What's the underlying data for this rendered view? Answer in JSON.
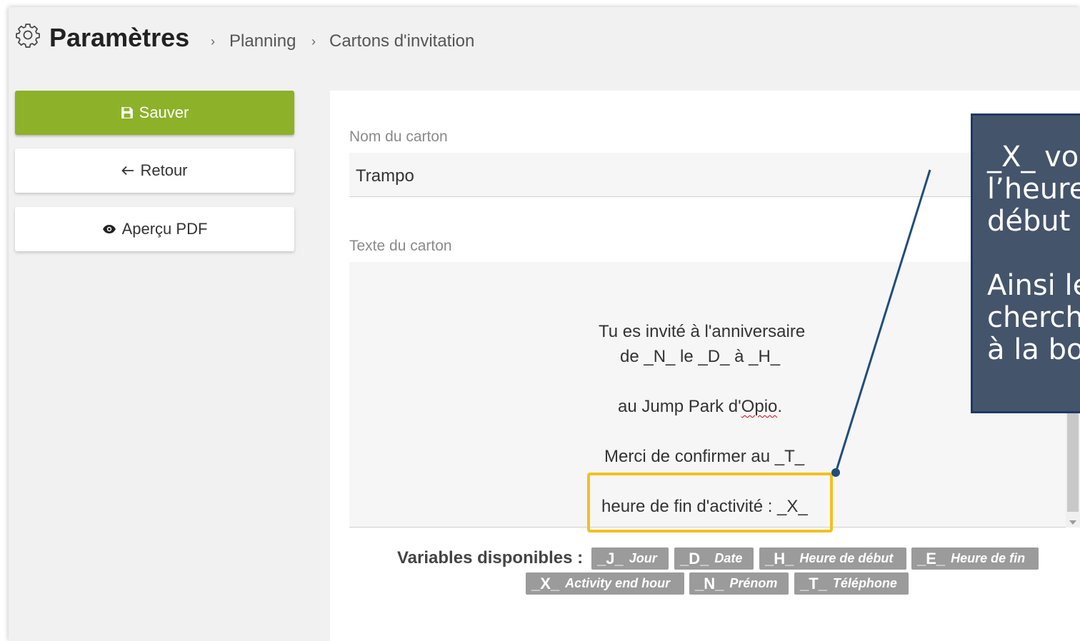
{
  "header": {
    "title": "Paramètres",
    "breadcrumb": [
      "Planning",
      "Cartons d'invitation"
    ],
    "separator": "›"
  },
  "actions": {
    "save_label": "Sauver",
    "back_label": "Retour",
    "pdf_label": "Aperçu PDF"
  },
  "form": {
    "name_label": "Nom du carton",
    "name_value": "Trampo",
    "text_label": "Texte du carton",
    "text_lines": [
      "Tu es invité à l'anniversaire",
      "de _N_ le _D_ à _H_",
      "au Jump Park d'",
      "Opio",
      ".",
      "Merci de confirmer au _T_",
      "heure de fin d'activité : _X_"
    ]
  },
  "variables": {
    "label": "Variables disponibles :",
    "items": [
      {
        "code": "_J_",
        "desc": "Jour"
      },
      {
        "code": "_D_",
        "desc": "Date"
      },
      {
        "code": "_H_",
        "desc": "Heure de début"
      },
      {
        "code": "_E_",
        "desc": "Heure de fin"
      },
      {
        "code": "_X_",
        "desc": "Activity end hour"
      },
      {
        "code": "_N_",
        "desc": "Prénom"
      },
      {
        "code": "_T_",
        "desc": "Téléphone"
      }
    ]
  },
  "annotation": {
    "callout_text": "_X_ vo\nl’heure\ndébut\n\nAinsi le\ncherch\nà la bo",
    "callout_bg": "#44546a",
    "highlight_color": "#f3c021",
    "line_color": "#1f4e79"
  },
  "colors": {
    "save_button": "#8db129",
    "variable_chip": "#9b9b9b"
  }
}
